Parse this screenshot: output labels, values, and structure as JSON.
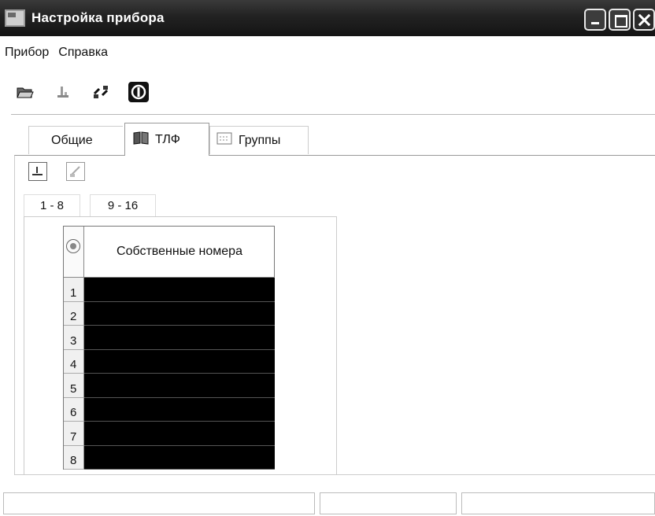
{
  "window": {
    "title": "Настройка прибора"
  },
  "menu": {
    "items": [
      {
        "label": "Прибор"
      },
      {
        "label": "Справка"
      }
    ]
  },
  "toolbar": {
    "icons": [
      "open-folder-icon",
      "save-icon",
      "connect-icon",
      "power-icon"
    ]
  },
  "tabs": [
    {
      "label": "Общие",
      "icon": "general-icon"
    },
    {
      "label": "ТЛФ",
      "icon": "phonebook-icon",
      "selected": true
    },
    {
      "label": "Группы",
      "icon": "groups-icon"
    }
  ],
  "subtabs": [
    {
      "label": "1 - 8",
      "selected": true
    },
    {
      "label": "9 - 16"
    }
  ],
  "grid": {
    "header": "Собственные номера",
    "rows": [
      "1",
      "2",
      "3",
      "4",
      "5",
      "6",
      "7",
      "8"
    ]
  }
}
